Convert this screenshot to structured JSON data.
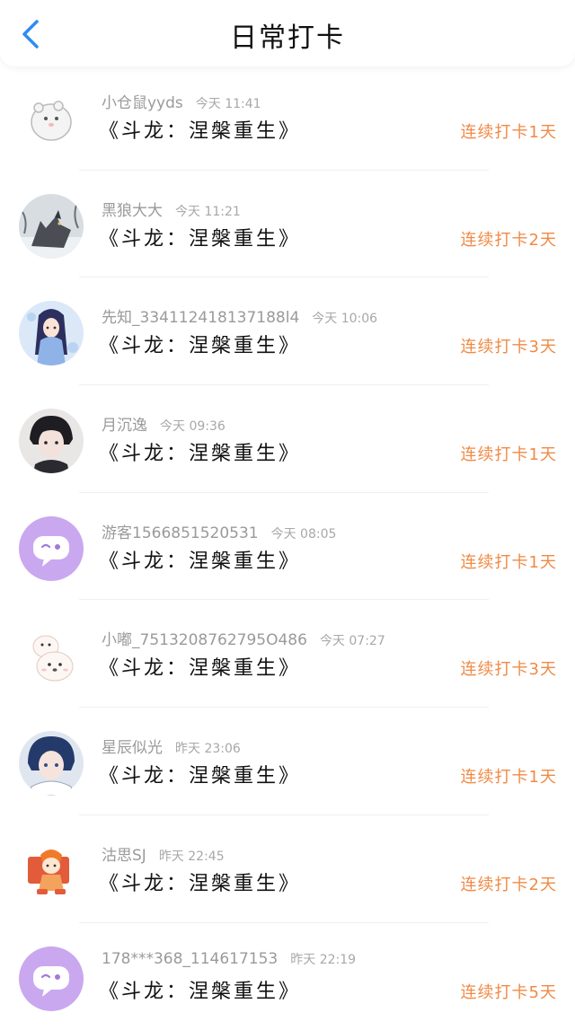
{
  "header": {
    "title": "日常打卡"
  },
  "items": [
    {
      "username": "小仓鼠yyds",
      "time": "今天 11:41",
      "book": "《斗龙：涅槃重生》",
      "streak": "连续打卡1天",
      "avatar": "hamster-avatar"
    },
    {
      "username": "黑狼大大",
      "time": "今天 11:21",
      "book": "《斗龙：涅槃重生》",
      "streak": "连续打卡2天",
      "avatar": "wolf-avatar"
    },
    {
      "username": "先知_334112418137188l4",
      "time": "今天 10:06",
      "book": "《斗龙：涅槃重生》",
      "streak": "连续打卡3天",
      "avatar": "anime-girl-avatar"
    },
    {
      "username": "月沉逸",
      "time": "今天 09:36",
      "book": "《斗龙：涅槃重生》",
      "streak": "连续打卡1天",
      "avatar": "anime-boy-avatar"
    },
    {
      "username": "游客1566851520531",
      "time": "今天 08:05",
      "book": "《斗龙：涅槃重生》",
      "streak": "连续打卡1天",
      "avatar": "default-chat-avatar"
    },
    {
      "username": "小嘟_7513208762795O486",
      "time": "今天 07:27",
      "book": "《斗龙：涅槃重生》",
      "streak": "连续打卡3天",
      "avatar": "puppy-avatar"
    },
    {
      "username": "星辰似光",
      "time": "昨天 23:06",
      "book": "《斗龙：涅槃重生》",
      "streak": "连续打卡1天",
      "avatar": "anime-boy-blue-avatar"
    },
    {
      "username": "沽思SJ",
      "time": "昨天 22:45",
      "book": "《斗龙：涅槃重生》",
      "streak": "连续打卡2天",
      "avatar": "chibi-avatar"
    },
    {
      "username": "178***368_114617153",
      "time": "昨天 22:19",
      "book": "《斗龙：涅槃重生》",
      "streak": "连续打卡5天",
      "avatar": "default-chat-avatar"
    }
  ],
  "colors": {
    "accent_blue": "#2f8cf0",
    "streak_orange": "#f08a45",
    "default_avatar_purple": "#c9a8f0"
  }
}
